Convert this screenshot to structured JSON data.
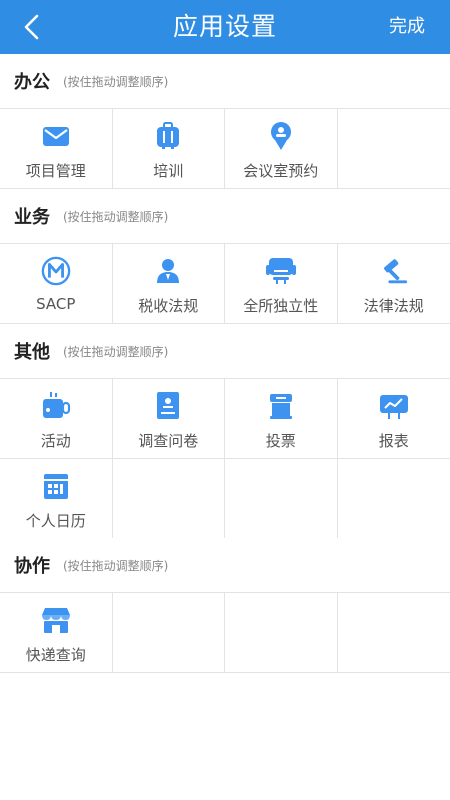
{
  "header": {
    "title": "应用设置",
    "done_label": "完成"
  },
  "sections": [
    {
      "name": "办公",
      "hint": "(按住拖动调整顺序)",
      "items": [
        {
          "label": "项目管理",
          "icon": "mail-icon"
        },
        {
          "label": "培训",
          "icon": "suitcase-icon"
        },
        {
          "label": "会议室预约",
          "icon": "badge-icon"
        }
      ]
    },
    {
      "name": "业务",
      "hint": "(按住拖动调整顺序)",
      "items": [
        {
          "label": "SACP",
          "icon": "m-circle-icon"
        },
        {
          "label": "税收法规",
          "icon": "person-icon"
        },
        {
          "label": "全所独立性",
          "icon": "chair-icon"
        },
        {
          "label": "法律法规",
          "icon": "gavel-icon"
        }
      ]
    },
    {
      "name": "其他",
      "hint": "(按住拖动调整顺序)",
      "items": [
        {
          "label": "活动",
          "icon": "cup-icon"
        },
        {
          "label": "调查问卷",
          "icon": "notebook-icon"
        },
        {
          "label": "投票",
          "icon": "ballot-box-icon"
        },
        {
          "label": "报表",
          "icon": "chart-board-icon"
        },
        {
          "label": "个人日历",
          "icon": "calendar-icon"
        }
      ]
    },
    {
      "name": "协作",
      "hint": "(按住拖动调整顺序)",
      "items": [
        {
          "label": "快递查询",
          "icon": "shop-icon"
        }
      ]
    }
  ],
  "colors": {
    "header": "#2f8de4",
    "icon_blue": "#3d93ef",
    "divider": "#e3e3e3"
  }
}
